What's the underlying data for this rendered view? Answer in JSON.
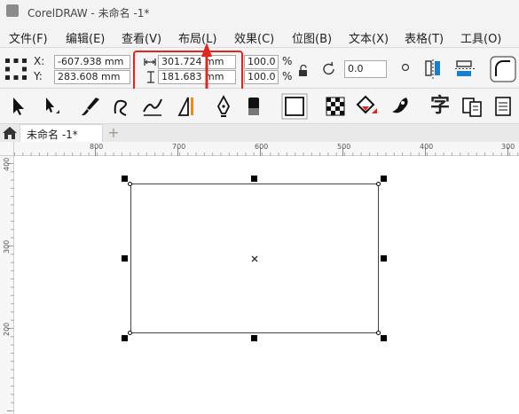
{
  "window": {
    "title": "CorelDRAW - 未命名 -1*"
  },
  "menu": {
    "items": [
      {
        "label": "文件(F)"
      },
      {
        "label": "编辑(E)"
      },
      {
        "label": "查看(V)"
      },
      {
        "label": "布局(L)"
      },
      {
        "label": "效果(C)"
      },
      {
        "label": "位图(B)"
      },
      {
        "label": "文本(X)"
      },
      {
        "label": "表格(T)"
      },
      {
        "label": "工具(O)"
      }
    ]
  },
  "property_bar": {
    "x_label": "X:",
    "y_label": "Y:",
    "x_value": "-607.938 mm",
    "y_value": "283.608 mm",
    "width_value": "301.724 mm",
    "height_value": "181.683 mm",
    "scale_x": "100.0",
    "scale_y": "100.0",
    "percent": "%",
    "rotation": "0.0"
  },
  "toolbox": {
    "icons": [
      "pick-tool-icon",
      "shape-tool-icon",
      "artistic-media-icon",
      "bezier-icon",
      "calligraphy-icon",
      "dimension-icon",
      "pen-icon",
      "eraser-icon",
      "rectangle-icon",
      "transparency-icon",
      "fill-icon",
      "interactive-fill-icon",
      "text-tool-icon",
      "object-properties-icon",
      "pages-icon"
    ],
    "text_tool_glyph": "字"
  },
  "tabs": {
    "active_label": "未命名 -1*",
    "add_glyph": "+"
  },
  "ruler": {
    "top_ticks": [
      "800",
      "700",
      "600",
      "500",
      "400",
      "300"
    ],
    "left_ticks": [
      "400",
      "300",
      "200"
    ]
  },
  "colors": {
    "highlight": "#e0261e",
    "accent_blue": "#1a7fd1"
  }
}
